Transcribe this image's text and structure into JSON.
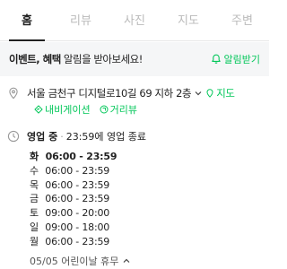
{
  "tabs": [
    {
      "label": "홈",
      "active": true
    },
    {
      "label": "리뷰",
      "active": false
    },
    {
      "label": "사진",
      "active": false
    },
    {
      "label": "지도",
      "active": false
    },
    {
      "label": "주변",
      "active": false
    }
  ],
  "banner": {
    "text_bold": "이벤트, 혜택",
    "text_rest": " 알림을 받아보세요!",
    "action_label": "알림받기",
    "action_icon": "bell-icon"
  },
  "address": {
    "text": "서울 금천구 디지털로10길 69 지하 2층",
    "map_link": "지도",
    "navigation_link": "내비게이션",
    "street_view_link": "거리뷰"
  },
  "hours": {
    "status": "영업 중",
    "status_detail": "23:59에 영업 종료",
    "schedule": [
      {
        "day": "화",
        "time": "06:00 - 23:59",
        "today": true
      },
      {
        "day": "수",
        "time": "06:00 - 23:59",
        "today": false
      },
      {
        "day": "목",
        "time": "06:00 - 23:59",
        "today": false
      },
      {
        "day": "금",
        "time": "06:00 - 23:59",
        "today": false
      },
      {
        "day": "토",
        "time": "09:00 - 20:00",
        "today": false
      },
      {
        "day": "일",
        "time": "09:00 - 18:00",
        "today": false
      },
      {
        "day": "월",
        "time": "06:00 - 23:59",
        "today": false
      }
    ],
    "holiday_note": "05/05 어린이날 휴무"
  },
  "colors": {
    "accent": "#03c75a",
    "text": "#222222",
    "inactive_tab": "#bbbbbb"
  }
}
